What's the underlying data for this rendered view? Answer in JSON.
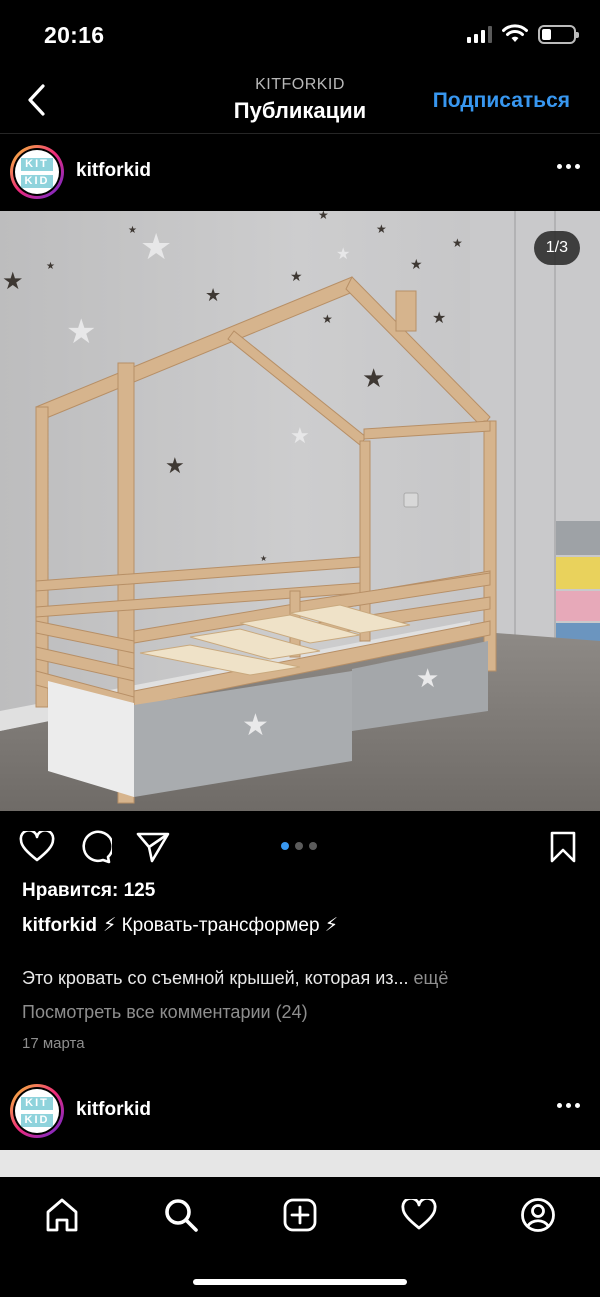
{
  "status_bar": {
    "time": "20:16",
    "battery_level": 0.3
  },
  "nav": {
    "subtitle": "KITFORKID",
    "title": "Публикации",
    "follow_label": "Подписаться",
    "back_icon": "chevron-left-icon"
  },
  "post": {
    "username": "kitforkid",
    "avatar_text": [
      "KIT",
      "KID"
    ],
    "image_counter": "1/3",
    "carousel": {
      "total": 3,
      "active": 1
    },
    "likes": "Нравится: 125",
    "caption_user": "kitforkid",
    "caption_text": "⚡ Кровать-трансформер ⚡",
    "description": "Это кровать со съемной крышей, которая из...",
    "more_label": "ещё",
    "view_comments": "Посмотреть все комментарии (24)",
    "date": "17 марта"
  },
  "next_post": {
    "username": "kitforkid"
  },
  "tabbar": {
    "items": [
      "home-icon",
      "search-icon",
      "create-icon",
      "activity-heart-icon",
      "profile-icon"
    ]
  },
  "colors": {
    "accent": "#3897f0",
    "background": "#000000",
    "muted": "#8e8e8e"
  }
}
